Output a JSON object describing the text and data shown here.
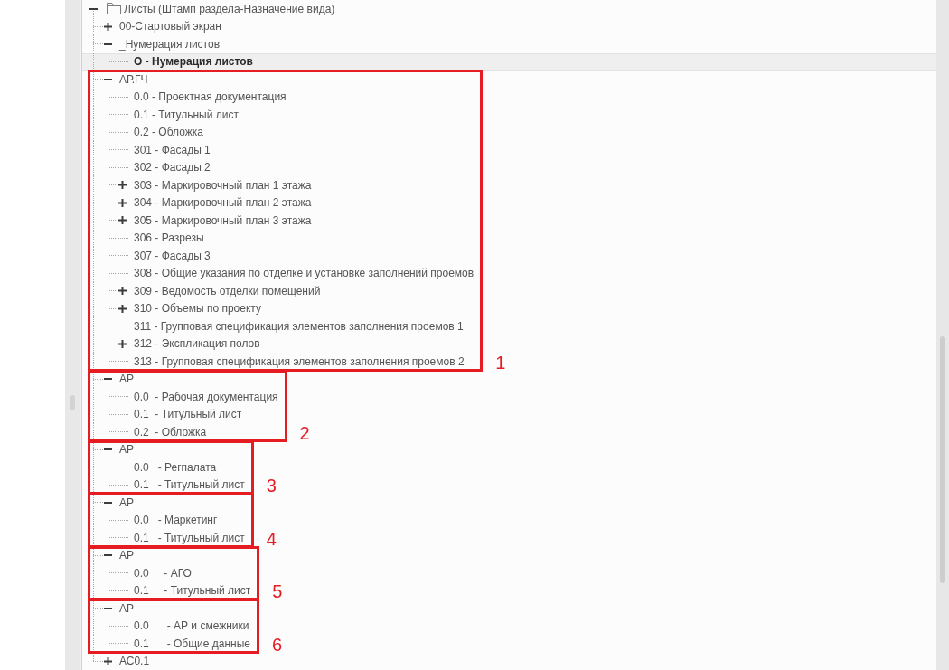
{
  "tree": {
    "items": [
      {
        "label": "Листы (Штамп раздела-Назначение вида)",
        "kind": "folder",
        "expanded": true,
        "selected": false,
        "children": [
          {
            "label": "00-Стартовый экран",
            "expanded": false,
            "selected": false
          },
          {
            "label": "_Нумерация листов",
            "expanded": true,
            "selected": false,
            "children": [
              {
                "label": "О - Нумерация листов",
                "selected": true
              }
            ]
          },
          {
            "label": "АР.ГЧ",
            "expanded": true,
            "selected": false,
            "annotation": "1",
            "children": [
              {
                "label": "0.0 - Проектная документация",
                "selected": false
              },
              {
                "label": "0.1 - Титульный лист",
                "selected": false
              },
              {
                "label": "0.2 - Обложка",
                "selected": false
              },
              {
                "label": "301 - Фасады 1",
                "selected": false
              },
              {
                "label": "302 - Фасады 2",
                "selected": false
              },
              {
                "label": "303 - Маркировочный план 1 этажа",
                "expanded": false,
                "selected": false
              },
              {
                "label": "304 - Маркировочный план 2 этажа",
                "expanded": false,
                "selected": false
              },
              {
                "label": "305 - Маркировочный план 3 этажа",
                "expanded": false,
                "selected": false
              },
              {
                "label": "306 - Разрезы",
                "selected": false
              },
              {
                "label": "307 - Фасады 3",
                "selected": false
              },
              {
                "label": "308 - Общие указания по отделке и установке заполнений проемов",
                "selected": false
              },
              {
                "label": "309 - Ведомость отделки помещений",
                "expanded": false,
                "selected": false
              },
              {
                "label": "310 - Объемы по проекту",
                "expanded": false,
                "selected": false
              },
              {
                "label": "311 - Групповая спецификация элементов заполнения проемов 1",
                "selected": false
              },
              {
                "label": "312 - Экспликация полов",
                "expanded": false,
                "selected": false
              },
              {
                "label": "313 - Групповая спецификация элементов заполнения проемов 2",
                "selected": false
              }
            ]
          },
          {
            "label": "АР",
            "expanded": true,
            "selected": false,
            "annotation": "2",
            "children": [
              {
                "label": "0.0  - Рабочая документация",
                "selected": false
              },
              {
                "label": "0.1  - Титульный лист",
                "selected": false
              },
              {
                "label": "0.2  - Обложка",
                "selected": false
              }
            ]
          },
          {
            "label": "АР",
            "expanded": true,
            "selected": false,
            "annotation": "3",
            "children": [
              {
                "label": "0.0   - Регпалата",
                "selected": false
              },
              {
                "label": "0.1   - Титульный лист",
                "selected": false
              }
            ]
          },
          {
            "label": "АР",
            "expanded": true,
            "selected": false,
            "annotation": "4",
            "children": [
              {
                "label": "0.0   - Маркетинг",
                "selected": false
              },
              {
                "label": "0.1   - Титульный лист",
                "selected": false
              }
            ]
          },
          {
            "label": "АР",
            "expanded": true,
            "selected": false,
            "annotation": "5",
            "children": [
              {
                "label": "0.0     - АГО",
                "selected": false
              },
              {
                "label": "0.1     - Титульный лист",
                "selected": false
              }
            ]
          },
          {
            "label": "АР",
            "expanded": true,
            "selected": false,
            "annotation": "6",
            "children": [
              {
                "label": "0.0      - АР и смежники",
                "selected": false
              },
              {
                "label": "0.1      - Общие данные",
                "selected": false
              }
            ]
          },
          {
            "label": "АС0.1",
            "expanded": false,
            "selected": false
          }
        ]
      }
    ]
  }
}
